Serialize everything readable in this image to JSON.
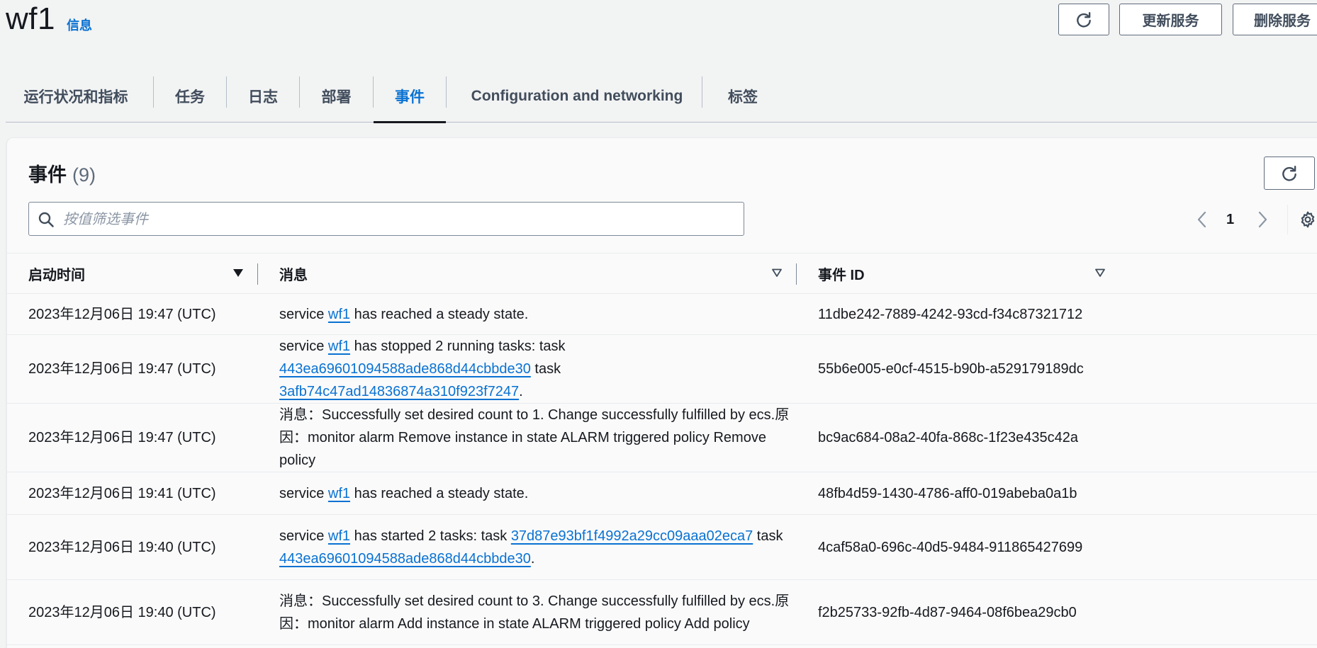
{
  "header": {
    "title": "wf1",
    "info_label": "信息",
    "update_button": "更新服务",
    "delete_button": "删除服务"
  },
  "tabs": [
    {
      "label": "运行状况和指标",
      "active": false
    },
    {
      "label": "任务",
      "active": false
    },
    {
      "label": "日志",
      "active": false
    },
    {
      "label": "部署",
      "active": false
    },
    {
      "label": "事件",
      "active": true
    },
    {
      "label": "Configuration and networking",
      "active": false
    },
    {
      "label": "标签",
      "active": false
    }
  ],
  "events": {
    "title": "事件",
    "count": "(9)",
    "search_placeholder": "按值筛选事件",
    "page": "1",
    "columns": {
      "time": "启动时间",
      "message": "消息",
      "event_id": "事件 ID"
    },
    "rows": [
      {
        "time": "2023年12月06日 19:47 (UTC)",
        "message": [
          {
            "t": "service "
          },
          {
            "t": "wf1",
            "link": true
          },
          {
            "t": " has reached a steady state."
          }
        ],
        "event_id": "11dbe242-7889-4242-93cd-f34c87321712"
      },
      {
        "time": "2023年12月06日 19:47 (UTC)",
        "message": [
          {
            "t": "service "
          },
          {
            "t": "wf1",
            "link": true
          },
          {
            "t": " has stopped 2 running tasks: task "
          },
          {
            "t": "443ea69601094588ade868d44cbbde30",
            "link": true
          },
          {
            "t": " task "
          },
          {
            "t": "3afb74c47ad14836874a310f923f7247",
            "link": true
          },
          {
            "t": "."
          }
        ],
        "event_id": "55b6e005-e0cf-4515-b90b-a529179189dc"
      },
      {
        "time": "2023年12月06日 19:47 (UTC)",
        "message": [
          {
            "t": "消息：Successfully set desired count to 1. Change successfully fulfilled by ecs.原因：monitor alarm Remove instance in state ALARM triggered policy Remove policy"
          }
        ],
        "event_id": "bc9ac684-08a2-40fa-868c-1f23e435c42a"
      },
      {
        "time": "2023年12月06日 19:41 (UTC)",
        "message": [
          {
            "t": "service "
          },
          {
            "t": "wf1",
            "link": true
          },
          {
            "t": " has reached a steady state."
          }
        ],
        "event_id": "48fb4d59-1430-4786-aff0-019abeba0a1b"
      },
      {
        "time": "2023年12月06日 19:40 (UTC)",
        "message": [
          {
            "t": "service "
          },
          {
            "t": "wf1",
            "link": true
          },
          {
            "t": " has started 2 tasks: task "
          },
          {
            "t": "37d87e93bf1f4992a29cc09aaa02eca7",
            "link": true
          },
          {
            "t": " task "
          },
          {
            "t": "443ea69601094588ade868d44cbbde30",
            "link": true
          },
          {
            "t": "."
          }
        ],
        "event_id": "4caf58a0-696c-40d5-9484-911865427699"
      },
      {
        "time": "2023年12月06日 19:40 (UTC)",
        "message": [
          {
            "t": "消息：Successfully set desired count to 3. Change successfully fulfilled by ecs.原因：monitor alarm Add instance in state ALARM triggered policy Add policy"
          }
        ],
        "event_id": "f2b25733-92fb-4d87-9464-08f6bea29cb0"
      }
    ]
  },
  "icons": {
    "refresh": "refresh-icon",
    "search": "search-icon",
    "prev": "chevron-left-icon",
    "next": "chevron-right-icon",
    "settings": "gear-icon",
    "sort_desc": "sort-descending-icon",
    "sort_none": "sort-caret-icon"
  },
  "colors": {
    "accent": "#0972d3",
    "text": "#16191f",
    "background": "#f2f3f3"
  }
}
